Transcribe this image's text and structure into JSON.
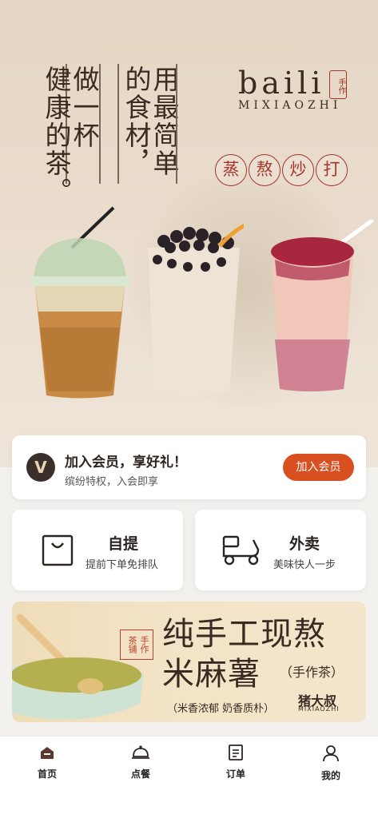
{
  "hero": {
    "slogan_col1": "健康的茶。",
    "slogan_col2": "做一杯",
    "slogan_col3": "的食材，",
    "slogan_col4": "用最简单",
    "brand_name": "baili",
    "brand_seal": "手作",
    "brand_sub": "MIXIAOZHI",
    "tags": [
      "蒸",
      "熬",
      "炒",
      "打"
    ]
  },
  "member": {
    "badge": "V",
    "title": "加入会员，享好礼！",
    "subtitle": "缤纷特权，入会即享",
    "button": "加入会员"
  },
  "options": [
    {
      "title": "自提",
      "subtitle": "提前下单免排队",
      "icon": "shopping-bag-icon"
    },
    {
      "title": "外卖",
      "subtitle": "美味快人一步",
      "icon": "scooter-icon"
    }
  ],
  "banner": {
    "seal": "手作茶铺",
    "title_line1": "纯手工现熬",
    "title_line2": "米麻薯",
    "title_suffix": "（手作茶）",
    "description": "（米香浓郁 奶香质朴）",
    "brand": "猪大叔",
    "brand_sub": "MIXIAOZHI"
  },
  "nav": [
    {
      "label": "首页",
      "icon": "home-icon",
      "active": true
    },
    {
      "label": "点餐",
      "icon": "cloche-icon",
      "active": false
    },
    {
      "label": "订单",
      "icon": "order-list-icon",
      "active": false
    },
    {
      "label": "我的",
      "icon": "user-icon",
      "active": false
    }
  ],
  "colors": {
    "accent": "#d8501f",
    "seal_red": "#a3352a",
    "text_dark": "#2b2522",
    "hero_bg": "#e6d7c4"
  }
}
